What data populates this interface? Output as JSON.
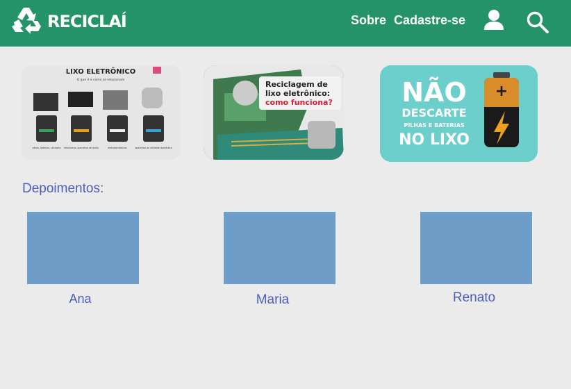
{
  "header": {
    "logo_text": "RECICLAÍ",
    "nav": {
      "sobre": "Sobre",
      "cadastre": "Cadastre-se"
    },
    "icons": [
      "recycle-icon",
      "user-icon",
      "search-icon"
    ]
  },
  "banners": {
    "b1": {
      "title": "LIXO ELETRÔNICO",
      "subtitle": "O que é e como se relacionam",
      "bins": [
        "pilhas, baterias, celulares",
        "televisores, aparelhos de áudio",
        "eletrodomésticos",
        "aparelhos de utilidade doméstica"
      ]
    },
    "b2": {
      "line1": "Reciclagem de",
      "line2": "lixo eletrônico:",
      "line3": "como funciona?"
    },
    "b3": {
      "line1": "NÃO",
      "line2": "DESCARTE",
      "line3": "PILHAS E BATERIAS",
      "line4": "NO LIXO"
    }
  },
  "testimonials": {
    "title": "Depoimentos:",
    "items": [
      {
        "name": "Ana"
      },
      {
        "name": "Maria"
      },
      {
        "name": "Renato"
      }
    ]
  },
  "colors": {
    "header": "#24936a",
    "accent_text": "#4a5fbf",
    "placeholder": "#6e9ec8",
    "background": "#ecebec"
  }
}
